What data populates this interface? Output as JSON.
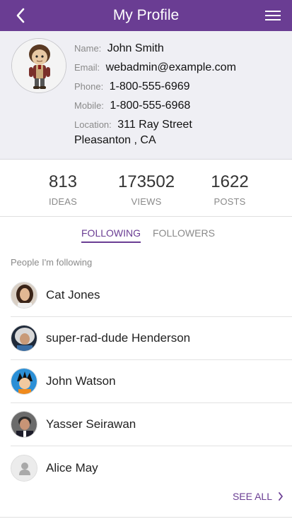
{
  "header": {
    "title": "My Profile",
    "back_icon": "chevron-left-icon",
    "menu_icon": "hamburger-menu-icon",
    "accent_color": "#6a3d93"
  },
  "profile": {
    "name_label": "Name:",
    "name": "John Smith",
    "email_label": "Email:",
    "email": "webadmin@example.com",
    "phone_label": "Phone:",
    "phone": "1-800-555-6969",
    "mobile_label": "Mobile:",
    "mobile": "1-800-555-6968",
    "location_label": "Location:",
    "location_line1": "311 Ray Street",
    "location_line2": "Pleasanton , CA"
  },
  "stats": [
    {
      "value": "813",
      "caption": "IDEAS"
    },
    {
      "value": "173502",
      "caption": "VIEWS"
    },
    {
      "value": "1622",
      "caption": "POSTS"
    }
  ],
  "tabs": [
    {
      "label": "FOLLOWING",
      "active": true
    },
    {
      "label": "FOLLOWERS",
      "active": false
    }
  ],
  "section_label": "People I'm following",
  "people": [
    {
      "name": "Cat Jones",
      "avatar": "woman-portrait"
    },
    {
      "name": "super-rad-dude Henderson",
      "avatar": "rocker-portrait"
    },
    {
      "name": "John Watson",
      "avatar": "cartoon-portrait"
    },
    {
      "name": "Yasser Seirawan",
      "avatar": "man-portrait"
    },
    {
      "name": "Alice May",
      "avatar": "default-person-icon"
    }
  ],
  "see_all": "SEE ALL"
}
